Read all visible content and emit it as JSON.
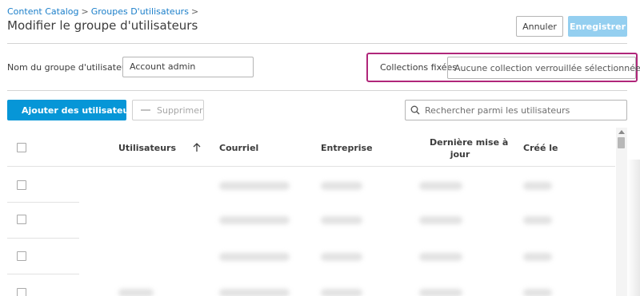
{
  "breadcrumb": {
    "item1": "Content Catalog",
    "item2": "Groupes D'utilisateurs",
    "sep": ">"
  },
  "page_title": "Modifier le groupe d'utilisateurs",
  "buttons": {
    "cancel": "Annuler",
    "save": "Enregistrer"
  },
  "form": {
    "name_label": "Nom du groupe d'utilisateurs",
    "required_mark": "*",
    "name_value": "Account admin",
    "collections_label": "Collections fixées",
    "collections_value": "Aucune collection verrouillée sélectionnée"
  },
  "toolbar": {
    "add_users": "Ajouter des utilisateurs",
    "delete": "Supprimer",
    "search_placeholder": "Rechercher parmi les utilisateurs"
  },
  "table": {
    "columns": {
      "users": "Utilisateurs",
      "email": "Courriel",
      "company": "Entreprise",
      "updated_line1": "Dernière mise à",
      "updated_line2": "jour",
      "created": "Créé le"
    }
  },
  "colors": {
    "primary": "#0696d7",
    "primary_disabled": "#94cff0",
    "link": "#1a7ec9",
    "highlight_border": "#b0267a",
    "required": "#d93030"
  },
  "icons": [
    "plus-icon",
    "minus-icon",
    "search-icon",
    "chevron-down-icon",
    "sort-arrow-up-icon"
  ]
}
